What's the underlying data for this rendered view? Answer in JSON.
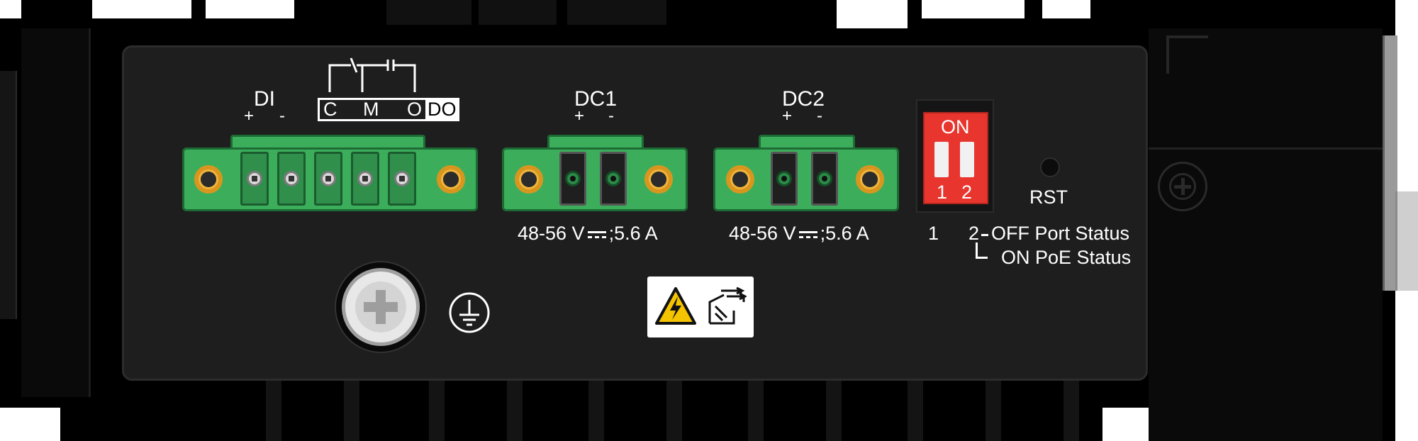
{
  "labels": {
    "di": "DI",
    "di_plus": "+",
    "di_minus": "-",
    "relay_c": "C",
    "relay_m": "M",
    "relay_o": "O",
    "relay_do": "DO",
    "dc1": "DC1",
    "dc1_plus": "+",
    "dc1_minus": "-",
    "dc2": "DC2",
    "dc2_plus": "+",
    "dc2_minus": "-",
    "dc1_rating": "48-56 V",
    "dc1_rating_suffix": ";5.6 A",
    "dc2_rating": "48-56 V",
    "dc2_rating_suffix": ";5.6 A",
    "dip_on": "ON",
    "dip_1": "1",
    "dip_2": "2",
    "rst": "RST",
    "dip_legend_1": "1",
    "dip_legend_2": "2",
    "dip_legend_off": "OFF Port Status",
    "dip_legend_on": "ON PoE Status"
  },
  "icons": {
    "ground": "ground-icon",
    "warning": "high-voltage-warning-icon",
    "hot_surface": "hot-surface-icon",
    "screw": "phillips-screw-icon"
  },
  "colors": {
    "chassis": "#000000",
    "panel": "#1e1e1e",
    "terminal_green": "#3cae5b",
    "terminal_edge": "#1d6b34",
    "mount_hole": "#f0b53a",
    "dip_switch": "#e8362e",
    "warning_yellow": "#f5c400",
    "label_text": "#ffffff"
  }
}
